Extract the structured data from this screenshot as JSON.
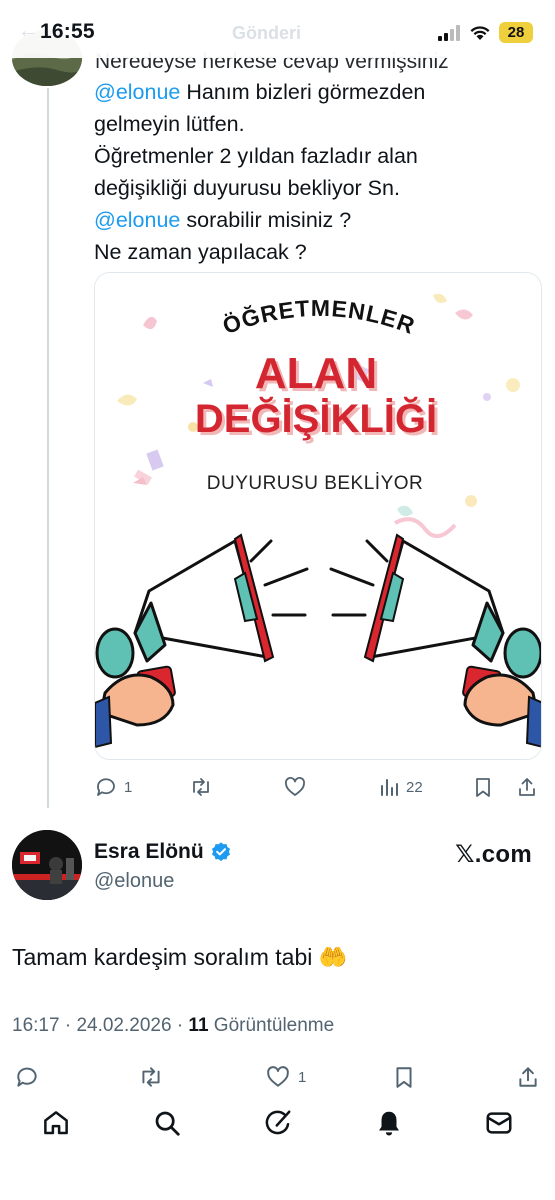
{
  "status_bar": {
    "time": "16:55",
    "battery": "28",
    "ghost_title": "Gönderi"
  },
  "top_tweet": {
    "cut_line": "Neredeyse herkese cevap vermişsiniz",
    "lines": [
      [
        {
          "t": "@elonue",
          "mention": true
        },
        {
          "t": " Hanım bizleri görmezden",
          "mention": false
        }
      ],
      [
        {
          "t": "gelmeyin lütfen.",
          "mention": false
        }
      ],
      [
        {
          "t": "Öğretmenler 2 yıldan fazladır alan",
          "mention": false
        }
      ],
      [
        {
          "t": "değişikliği duyurusu bekliyor Sn.",
          "mention": false
        }
      ],
      [
        {
          "t": "@elonue",
          "mention": true
        },
        {
          "t": " sorabilir misiniz  ?",
          "mention": false
        }
      ],
      [
        {
          "t": "Ne zaman yapılacak ?",
          "mention": false
        }
      ]
    ],
    "image": {
      "heading_arc": "ÖĞRETMENLER",
      "title_line1": "ALAN",
      "title_line2": "DEĞİŞİKLİĞİ",
      "subtitle": "DUYURUSU BEKLİYOR"
    },
    "actions": {
      "replies": "1",
      "retweets": "",
      "likes": "",
      "views": "22"
    }
  },
  "reply_tweet": {
    "author_name": "Esra Elönü",
    "author_handle": "@elonue",
    "brand": "𝕏.com",
    "text": "Tamam kardeşim soralım tabi",
    "emoji": "🤲",
    "time": "16:17",
    "date": "24.02.2026",
    "views_count": "11",
    "views_label": "Görüntülenme",
    "like_count": "1"
  },
  "colors": {
    "mention": "#1d9bf0",
    "verified": "#1d9bf0",
    "megaphone_red": "#d9262f",
    "megaphone_teal": "#5fc1b3",
    "title_red": "#d32630"
  },
  "icons": [
    "reply-icon",
    "retweet-icon",
    "like-icon",
    "views-icon",
    "bookmark-icon",
    "share-icon",
    "home-icon",
    "search-icon",
    "grok-icon",
    "notifications-icon",
    "messages-icon"
  ]
}
